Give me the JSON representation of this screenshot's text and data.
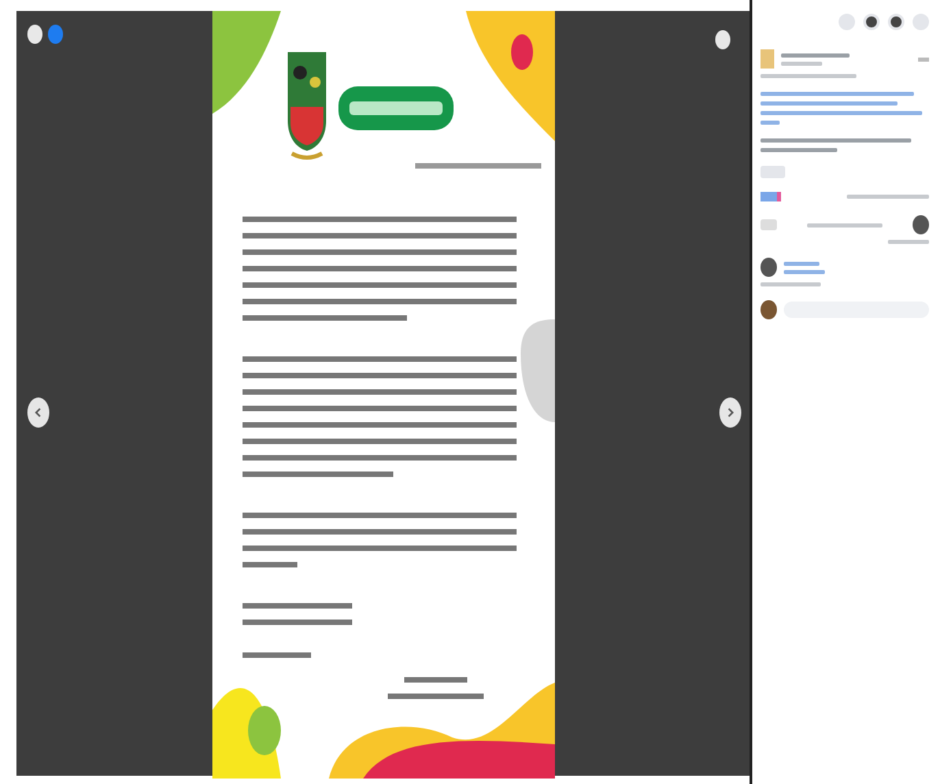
{
  "viewer": {
    "previous_enabled": true,
    "next_enabled": true
  },
  "post": {
    "blocks": [
      {
        "kind": "header"
      },
      {
        "kind": "link"
      },
      {
        "kind": "text"
      },
      {
        "kind": "button"
      },
      {
        "kind": "reactions"
      },
      {
        "kind": "actions"
      },
      {
        "kind": "comment"
      },
      {
        "kind": "composer"
      }
    ]
  }
}
